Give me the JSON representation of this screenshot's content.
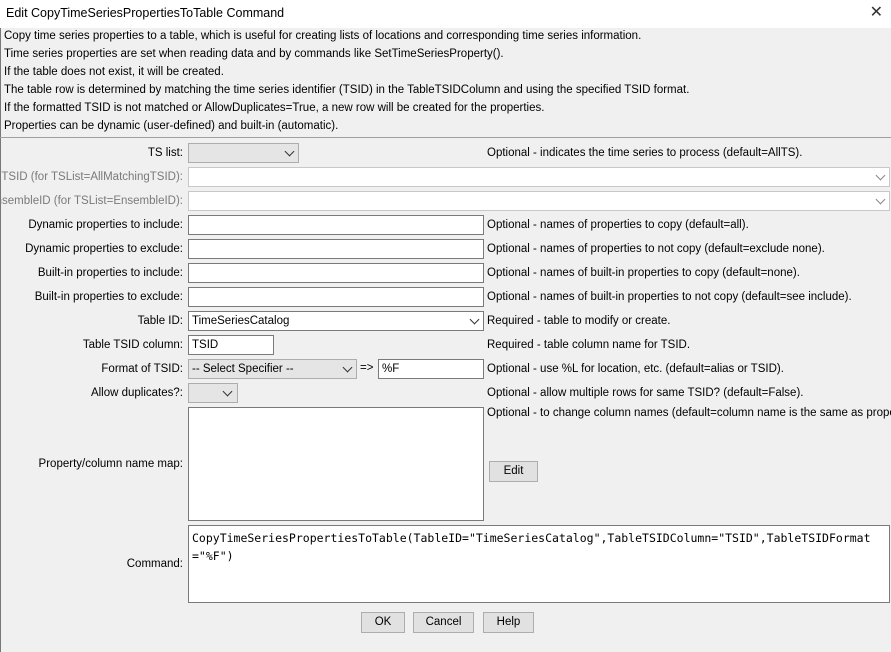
{
  "window": {
    "title": "Edit CopyTimeSeriesPropertiesToTable Command",
    "close_glyph": "✕"
  },
  "description": [
    "Copy time series properties to a table, which is useful for creating lists of locations and corresponding time series information.",
    "Time series properties are set when reading data and by commands like SetTimeSeriesProperty().",
    "If the table does not exist, it will be created.",
    "The table row is determined by matching the time series identifier (TSID) in the TableTSIDColumn and using the specified TSID format.",
    "If the formatted TSID is not matched or AllowDuplicates=True, a new row will be created for the properties.",
    "Properties can be dynamic (user-defined) and built-in (automatic)."
  ],
  "form": {
    "ts_list": {
      "label": "TS list:",
      "value": "",
      "hint": "Optional - indicates the time series to process (default=AllTS)."
    },
    "tsid": {
      "label": "TSID (for TSList=AllMatchingTSID):",
      "value": ""
    },
    "ensemble_id": {
      "label": "EnsembleID (for TSList=EnsembleID):",
      "value": ""
    },
    "dyn_include": {
      "label": "Dynamic properties to include:",
      "value": "",
      "hint": "Optional - names of properties to copy (default=all)."
    },
    "dyn_exclude": {
      "label": "Dynamic properties to exclude:",
      "value": "",
      "hint": "Optional - names of properties to not copy (default=exclude none)."
    },
    "builtin_include": {
      "label": "Built-in properties to include:",
      "value": "",
      "hint": "Optional - names of built-in properties to copy (default=none)."
    },
    "builtin_exclude": {
      "label": "Built-in properties to exclude:",
      "value": "",
      "hint": "Optional - names of built-in properties to not copy (default=see include)."
    },
    "table_id": {
      "label": "Table ID:",
      "value": "TimeSeriesCatalog",
      "hint": "Required - table to modify or create."
    },
    "table_tsid_column": {
      "label": "Table TSID column:",
      "value": "TSID",
      "hint": "Required - table column name for TSID."
    },
    "tsid_format": {
      "label": "Format of TSID:",
      "specifier": "-- Select Specifier --",
      "arrow": "=>",
      "value": "%F",
      "hint": "Optional - use %L for location, etc. (default=alias or TSID)."
    },
    "allow_duplicates": {
      "label": "Allow duplicates?:",
      "value": "",
      "hint": "Optional - allow multiple rows for same TSID? (default=False)."
    },
    "name_map": {
      "label": "Property/column name map:",
      "value": "",
      "hint": "Optional - to change column names (default=column name is the same as property).",
      "edit_label": "Edit"
    },
    "command": {
      "label": "Command:",
      "value": "CopyTimeSeriesPropertiesToTable(TableID=\"TimeSeriesCatalog\",TableTSIDColumn=\"TSID\",TableTSIDFormat=\"%F\")"
    }
  },
  "buttons": {
    "ok": "OK",
    "cancel": "Cancel",
    "help": "Help"
  }
}
